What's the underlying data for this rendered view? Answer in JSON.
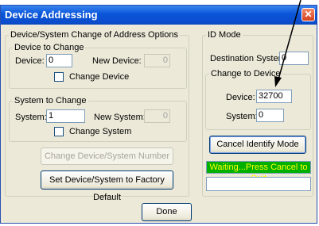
{
  "window": {
    "title": "Device Addressing",
    "close_glyph": "✕"
  },
  "left_group": {
    "legend": "Device/System Change of Address Options",
    "device_group": {
      "legend": "Device to Change",
      "device_label": "Device:",
      "device_value": "0",
      "new_device_label": "New Device:",
      "new_device_value": "0",
      "checkbox_label": "Change Device"
    },
    "system_group": {
      "legend": "System to Change",
      "system_label": "System:",
      "system_value": "1",
      "new_system_label": "New System:",
      "new_system_value": "0",
      "checkbox_label": "Change System"
    },
    "change_number_button": "Change Device/System Number",
    "factory_default_button": "Set Device/System to Factory Default"
  },
  "id_mode": {
    "legend": "ID Mode",
    "destination_label": "Destination System:",
    "destination_value": "0",
    "change_to_device": {
      "legend": "Change to Device",
      "device_label": "Device:",
      "device_value": "32700",
      "system_label": "System:",
      "system_value": "0"
    },
    "cancel_button": "Cancel Identify Mode",
    "status_text": "Waiting...Press Cancel to Quit",
    "status_color": "#00b000",
    "status_text_color": "#ffff00"
  },
  "footer": {
    "done_button": "Done"
  }
}
